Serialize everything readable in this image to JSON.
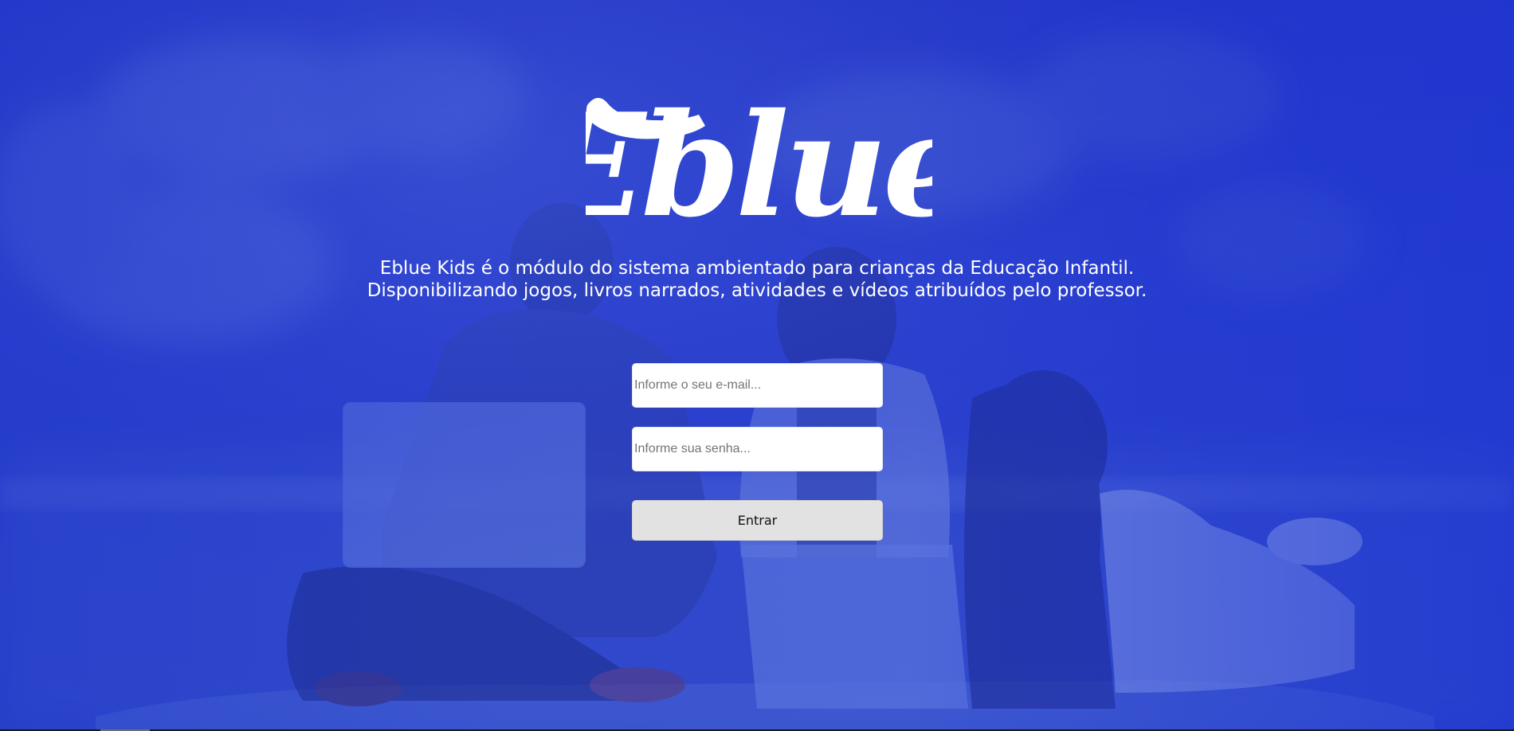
{
  "brand": {
    "logo_text": "Eblue"
  },
  "intro": {
    "line1": "Eblue Kids é o módulo do sistema ambientado para crianças da Educação Infantil.",
    "line2": "Disponibilizando jogos, livros narrados, atividades e vídeos atribuídos pelo professor."
  },
  "login": {
    "email_placeholder": "Informe o seu e-mail...",
    "password_placeholder": "Informe sua senha...",
    "submit_label": "Entrar"
  },
  "colors": {
    "background_blue": "#2a3fcf",
    "button_gray": "#e2e2e2",
    "text_white": "#ffffff"
  }
}
